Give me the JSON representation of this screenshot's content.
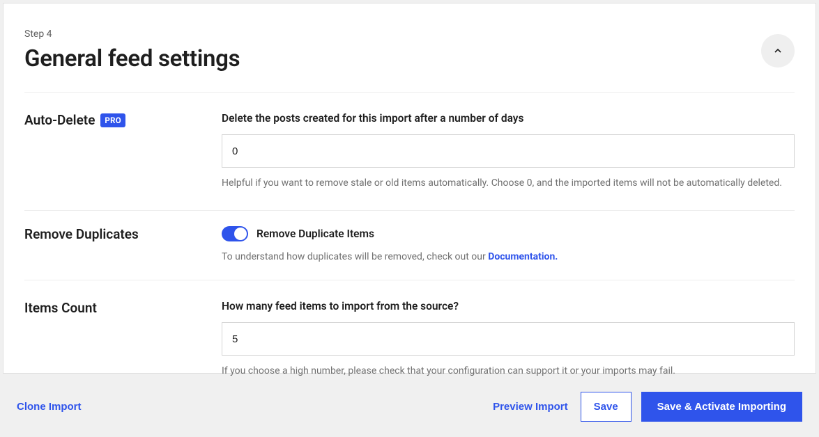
{
  "header": {
    "step_label": "Step 4",
    "title": "General feed settings"
  },
  "auto_delete": {
    "label": "Auto-Delete",
    "badge": "PRO",
    "field_title": "Delete the posts created for this import after a number of days",
    "value": "0",
    "help": "Helpful if you want to remove stale or old items automatically. Choose 0, and the imported items will not be automatically deleted."
  },
  "remove_duplicates": {
    "label": "Remove Duplicates",
    "toggle_label": "Remove Duplicate Items",
    "enabled": true,
    "help_prefix": "To understand how duplicates will be removed, check out our ",
    "doc_link_text": "Documentation."
  },
  "items_count": {
    "label": "Items Count",
    "field_title": "How many feed items to import from the source?",
    "value": "5",
    "help": "If you choose a high number, please check that your configuration can support it or your imports may fail."
  },
  "footer": {
    "clone": "Clone Import",
    "preview": "Preview Import",
    "save": "Save",
    "save_activate": "Save & Activate Importing"
  }
}
